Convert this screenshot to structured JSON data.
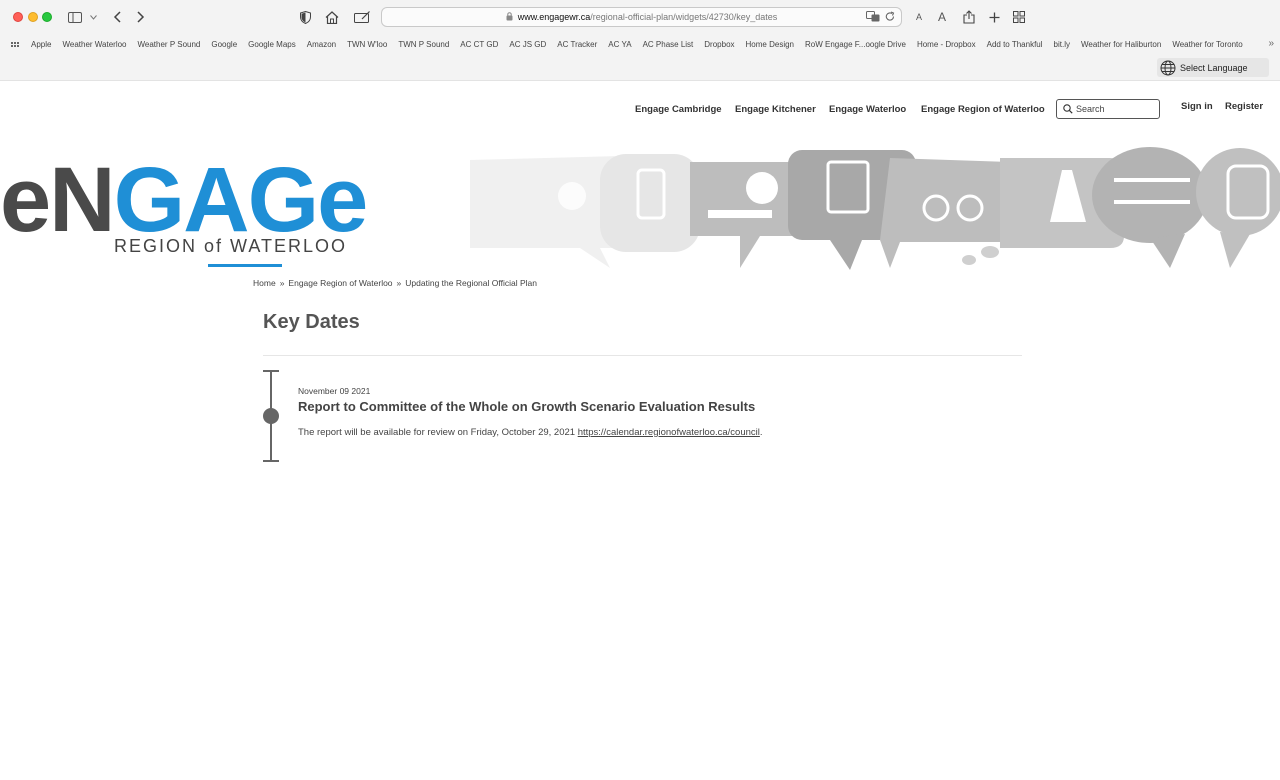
{
  "browser": {
    "url_domain": "www.engagewr.ca",
    "url_path": "/regional-official-plan/widgets/42730/key_dates",
    "text_size_small": "A",
    "text_size_large": "A",
    "bookmarks": [
      "Apple",
      "Weather Waterloo",
      "Weather P Sound",
      "Google",
      "Google Maps",
      "Amazon",
      "TWN W'loo",
      "TWN P Sound",
      "AC CT GD",
      "AC JS GD",
      "AC Tracker",
      "AC YA",
      "AC Phase List",
      "Dropbox",
      "Home Design",
      "RoW Engage F...oogle Drive",
      "Home - Dropbox",
      "Add to Thankful",
      "bit.ly",
      "Weather for Haliburton",
      "Weather for Toronto"
    ],
    "bookmarks_more": "»"
  },
  "language": {
    "label": "Select Language"
  },
  "nav": {
    "links": [
      "Engage Cambridge",
      "Engage Kitchener",
      "Engage Waterloo",
      "Engage Region of Waterloo"
    ],
    "search_placeholder": "Search",
    "sign_in": "Sign in",
    "register": "Register"
  },
  "logo": {
    "e1": "e",
    "n": "N",
    "gage": "GAGe",
    "subtitle": "REGION of WATERLOO"
  },
  "breadcrumb": {
    "items": [
      "Home",
      "Engage Region of Waterloo",
      "Updating the Regional Official Plan"
    ],
    "separator": "»"
  },
  "page": {
    "title": "Key Dates"
  },
  "events": [
    {
      "date": "November 09 2021",
      "title": "Report to Committee of the Whole on Growth Scenario Evaluation Results",
      "description": "The report will be available for review on Friday, October 29, 2021 ",
      "link": "https://calendar.regionofwaterloo.ca/council",
      "trailing": "."
    }
  ],
  "colors": {
    "brand_blue": "#1f8fd6",
    "brand_gray": "#4a4a4a"
  }
}
